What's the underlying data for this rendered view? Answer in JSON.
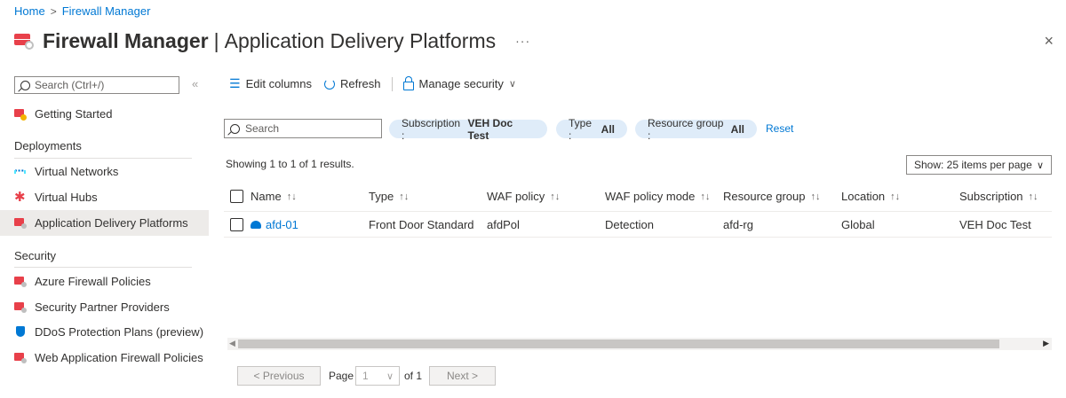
{
  "breadcrumb": {
    "home": "Home",
    "separator": ">",
    "current": "Firewall Manager"
  },
  "title": {
    "bold": "Firewall Manager",
    "separator": "|",
    "rest": "Application Delivery Platforms",
    "more": "···"
  },
  "close": "×",
  "sidebar": {
    "search_placeholder": "Search (Ctrl+/)",
    "collapse": "«",
    "getting_started": "Getting Started",
    "deployments_header": "Deployments",
    "deployments": [
      {
        "label": "Virtual Networks",
        "icon": "virtual-network-icon"
      },
      {
        "label": "Virtual Hubs",
        "icon": "virtual-hub-icon"
      },
      {
        "label": "Application Delivery Platforms",
        "icon": "firewall-icon",
        "active": true
      }
    ],
    "security_header": "Security",
    "security": [
      {
        "label": "Azure Firewall Policies",
        "icon": "firewall-icon"
      },
      {
        "label": "Security Partner Providers",
        "icon": "firewall-icon"
      },
      {
        "label": "DDoS Protection Plans (preview)",
        "icon": "shield-icon"
      },
      {
        "label": "Web Application Firewall Policies",
        "icon": "firewall-icon"
      }
    ]
  },
  "toolbar": {
    "edit_columns": "Edit columns",
    "refresh": "Refresh",
    "manage_security": "Manage security"
  },
  "filters": {
    "search_placeholder": "Search",
    "subscription_label": "Subscription :",
    "subscription_value": "VEH Doc Test",
    "type_label": "Type :",
    "type_value": "All",
    "resource_group_label": "Resource group :",
    "resource_group_value": "All",
    "reset": "Reset"
  },
  "results": {
    "showing": "Showing 1 to 1 of 1 results.",
    "page_size": "Show: 25 items per page"
  },
  "table": {
    "columns": [
      "Name",
      "Type",
      "WAF policy",
      "WAF policy mode",
      "Resource group",
      "Location",
      "Subscription"
    ],
    "sort_icon": "↑↓",
    "rows": [
      {
        "name": "afd-01",
        "type": "Front Door Standard",
        "waf_policy": "afdPol",
        "waf_mode": "Detection",
        "resource_group": "afd-rg",
        "location": "Global",
        "subscription": "VEH Doc Test"
      }
    ]
  },
  "pagination": {
    "previous": "< Previous",
    "page_label": "Page",
    "page_value": "1",
    "of": "of 1",
    "next": "Next >"
  },
  "colors": {
    "accent": "#0078d4",
    "pill": "#dfecf9",
    "active_nav": "#edebe9",
    "brand_red": "#e8404a"
  }
}
